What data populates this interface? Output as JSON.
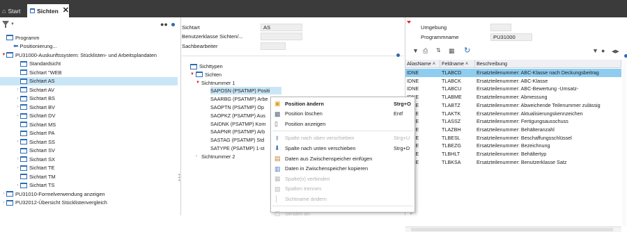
{
  "tabs": {
    "start": "Start",
    "sichten": "Sichten"
  },
  "left_tree": [
    {
      "label": "Programm",
      "indent": 0,
      "exp": "",
      "icon": "view"
    },
    {
      "label": "Positionierung...",
      "indent": 1,
      "exp": "",
      "icon": "arrow"
    },
    {
      "label": "PU31000-Auskunftssystem: Stücklisten- und Arbeitsplandaten",
      "indent": 0,
      "exp": "open",
      "icon": "view"
    },
    {
      "label": "Standardsicht",
      "indent": 2,
      "exp": "",
      "icon": "view"
    },
    {
      "label": "Sichtart \"WEB",
      "indent": 2,
      "exp": "",
      "icon": "view"
    },
    {
      "label": "Sichtart AS",
      "indent": 2,
      "exp": "",
      "icon": "view",
      "selected": true
    },
    {
      "label": "Sichtart AV",
      "indent": 2,
      "exp": "closed",
      "icon": "view"
    },
    {
      "label": "Sichtart BS",
      "indent": 2,
      "exp": "closed",
      "icon": "view"
    },
    {
      "label": "Sichtart BV",
      "indent": 2,
      "exp": "closed",
      "icon": "view"
    },
    {
      "label": "Sichtart DV",
      "indent": 2,
      "exp": "closed",
      "icon": "view"
    },
    {
      "label": "Sichtart MS",
      "indent": 2,
      "exp": "",
      "icon": "view"
    },
    {
      "label": "Sichtart PA",
      "indent": 2,
      "exp": "",
      "icon": "view"
    },
    {
      "label": "Sichtart SS",
      "indent": 2,
      "exp": "closed",
      "icon": "view"
    },
    {
      "label": "Sichtart SV",
      "indent": 2,
      "exp": "",
      "icon": "view"
    },
    {
      "label": "Sichtart SX",
      "indent": 2,
      "exp": "closed",
      "icon": "view"
    },
    {
      "label": "Sichtart TE",
      "indent": 2,
      "exp": "closed",
      "icon": "view"
    },
    {
      "label": "Sichtart TM",
      "indent": 2,
      "exp": "",
      "icon": "view"
    },
    {
      "label": "Sichtart TS",
      "indent": 2,
      "exp": "closed",
      "icon": "view"
    },
    {
      "label": "PU31010-Formelverwendung anzeigen",
      "indent": 0,
      "exp": "closed",
      "icon": "view"
    },
    {
      "label": "PU32012-Übersicht Stücklistenvergleich",
      "indent": 0,
      "exp": "closed",
      "icon": "view"
    }
  ],
  "mid_fields": [
    {
      "label": "Sichtart",
      "value": "AS"
    },
    {
      "label": "Benutzerklasse Sichten/...",
      "value": ""
    },
    {
      "label": "Sachbearbeiter",
      "value": ""
    }
  ],
  "mid_tree": [
    {
      "label": "Sichttypen",
      "indent": 0,
      "exp": "",
      "icon": true
    },
    {
      "label": "Sichten",
      "indent": 1,
      "exp": "red",
      "icon": true
    },
    {
      "label": "Sichtnummer 1",
      "indent": 2,
      "exp": "red",
      "icon": false
    },
    {
      "label": "SAPOSN (PSATMP) Positi",
      "indent": 3,
      "exp": "",
      "icon": false,
      "highlight": true
    },
    {
      "label": "SAARBG (PSATMP) Arbe",
      "indent": 3,
      "exp": "",
      "icon": false
    },
    {
      "label": "SAOPTN (PSATMP) Op",
      "indent": 3,
      "exp": "",
      "icon": false
    },
    {
      "label": "SAOPKZ (PSATMP) Aus",
      "indent": 3,
      "exp": "",
      "icon": false
    },
    {
      "label": "SAIDNK (PSATMP) Kom",
      "indent": 3,
      "exp": "",
      "icon": false
    },
    {
      "label": "SAAPNR (PSATMP) Arb",
      "indent": 3,
      "exp": "",
      "icon": false
    },
    {
      "label": "SASTAG (PSATMP) Std",
      "indent": 3,
      "exp": "",
      "icon": false
    },
    {
      "label": "SATYPE (PSATMP) 1-st",
      "indent": 3,
      "exp": "",
      "icon": false
    },
    {
      "label": "Sichtnummer 2",
      "indent": 2,
      "exp": "closed",
      "icon": false
    }
  ],
  "right_fields": [
    {
      "label": "Umgebung",
      "value": ""
    },
    {
      "label": "Programmname",
      "value": "PU31000"
    }
  ],
  "grid": {
    "headers": [
      "AliasName",
      "Feldname",
      "Beschreibung"
    ],
    "rows": [
      {
        "alias": "IDNE",
        "feld": "TLABCD",
        "desc": "Ersatzteilenummer: ABC-Klasse nach Deckungsbeitrag",
        "selected": true
      },
      {
        "alias": "IDNE",
        "feld": "TLABCK",
        "desc": "Ersatzteilenummer: ABC-Klasse"
      },
      {
        "alias": "IDNE",
        "feld": "TLABCU",
        "desc": "Ersatzteilenummer: ABC-Bewertung -Umsatz-"
      },
      {
        "alias": "IDNE",
        "feld": "TLABME",
        "desc": "Ersatzteilenummer: Abmessung"
      },
      {
        "alias": "IDNE",
        "feld": "TLABTZ",
        "desc": "Ersatzteilenummer: Abweichende Teilenummer zulässig"
      },
      {
        "alias": "IDNE",
        "feld": "TLAKTK",
        "desc": "Ersatzteilenummer: Aktualisierungskennzeichen"
      },
      {
        "alias": "IDNE",
        "feld": "TLASSZ",
        "desc": "Ersatzteilenummer: Fertigungsausschuss"
      },
      {
        "alias": "IDNE",
        "feld": "TLAZBH",
        "desc": "Ersatzteilenummer: Behälteranzahl"
      },
      {
        "alias": "IDNE",
        "feld": "TLBESL",
        "desc": "Ersatzteilenummer: Beschaffungsschlüssel"
      },
      {
        "alias": "IDNE",
        "feld": "TLBEZG",
        "desc": "Ersatzteilenummer: Bezeichnung"
      },
      {
        "alias": "IDNE",
        "feld": "TLBHLT",
        "desc": "Ersatzteilenummer: Behältertyp"
      },
      {
        "alias": "IDNE",
        "feld": "TLBKSA",
        "desc": "Ersatzteilenummer: Benutzerklasse Satz"
      }
    ]
  },
  "context_menu": [
    {
      "label": "Position ändern",
      "shortcut": "Strg+O",
      "bold": true,
      "disabled": false,
      "icon": "folder"
    },
    {
      "label": "Position löschen",
      "shortcut": "Entf",
      "bold": false,
      "disabled": false,
      "icon": "trash"
    },
    {
      "label": "Position anzeigen",
      "shortcut": "",
      "bold": false,
      "disabled": false,
      "icon": "doc"
    },
    {
      "sep": true
    },
    {
      "label": "Spalte nach oben verschieben",
      "shortcut": "Strg+U",
      "bold": false,
      "disabled": true,
      "icon": "up"
    },
    {
      "label": "Spalte nach unten verschieben",
      "shortcut": "Strg+D",
      "bold": false,
      "disabled": false,
      "icon": "down"
    },
    {
      "label": "Daten aus Zwischenspeicher einfügen",
      "shortcut": "",
      "bold": false,
      "disabled": false,
      "icon": "paste"
    },
    {
      "label": "Daten in Zwischenspeicher kopieren",
      "shortcut": "",
      "bold": false,
      "disabled": false,
      "icon": "copy"
    },
    {
      "label": "Spalte(n) verbinden",
      "shortcut": "",
      "bold": false,
      "disabled": true,
      "icon": "join"
    },
    {
      "label": "Spalten trennen",
      "shortcut": "",
      "bold": false,
      "disabled": true,
      "icon": "split"
    },
    {
      "label": "Sichtname ändern",
      "shortcut": "",
      "bold": false,
      "disabled": true,
      "icon": "bar"
    },
    {
      "sep": true
    },
    {
      "label": "Senden an",
      "shortcut": "",
      "bold": false,
      "disabled": true,
      "icon": "send",
      "submenu": true
    }
  ],
  "colors": {
    "topbar": "#3b3b3b",
    "accent": "#2a6bb5",
    "selected_row": "#8fcdf0",
    "selected_tree": "#c9e6f6"
  }
}
